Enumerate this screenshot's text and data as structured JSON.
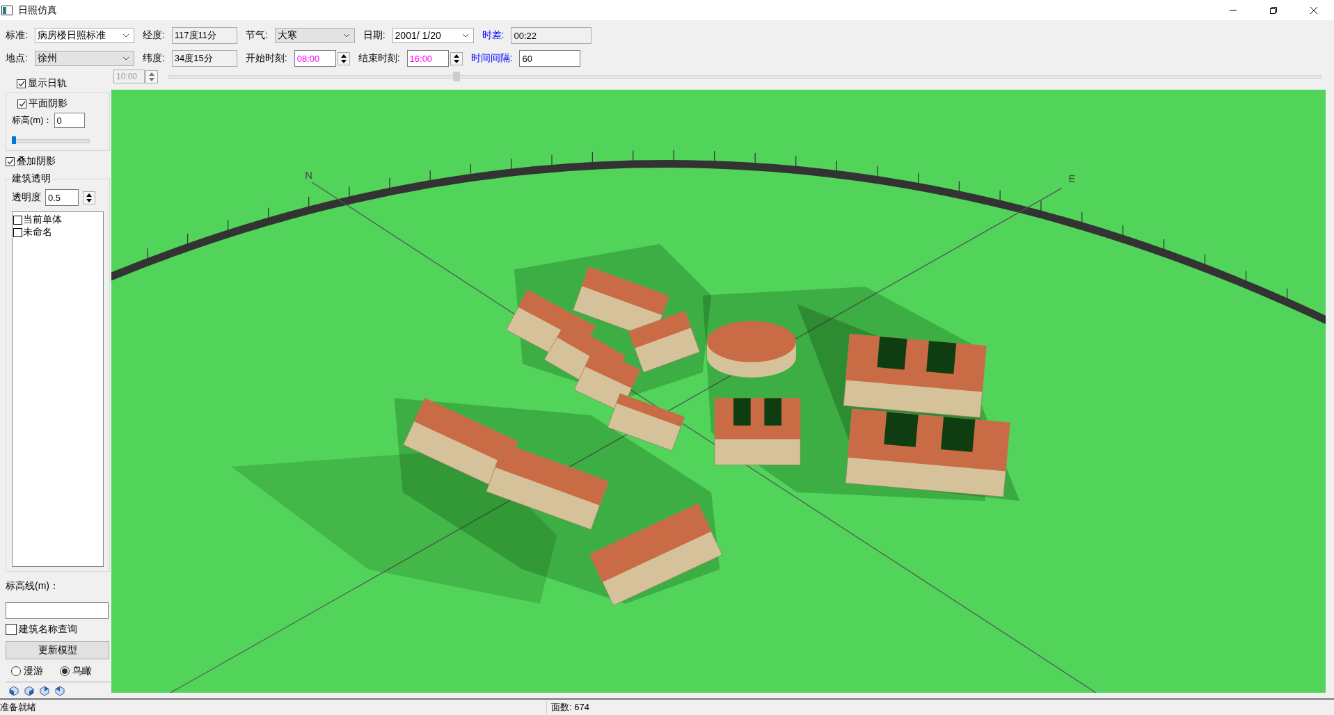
{
  "window": {
    "title": "日照仿真"
  },
  "toolbar": {
    "rows": [
      [
        {
          "label": "标准:",
          "kind": "combo",
          "value": "病房楼日照标准",
          "readonly": false,
          "accent": false
        },
        {
          "label": "经度:",
          "kind": "text",
          "value": "117度11分",
          "readonly": true,
          "accent": false
        },
        {
          "label": "节气:",
          "kind": "combo",
          "value": "大寒",
          "readonly": true,
          "accent": false
        },
        {
          "label": "日期:",
          "kind": "combo",
          "value": "2001/ 1/20",
          "readonly": false,
          "accent": false
        },
        {
          "label": "时差:",
          "kind": "text",
          "value": "00:22",
          "readonly": true,
          "accent": true
        }
      ],
      [
        {
          "label": "地点:",
          "kind": "combo",
          "value": "徐州",
          "readonly": true,
          "accent": false
        },
        {
          "label": "纬度:",
          "kind": "text",
          "value": "34度15分",
          "readonly": true,
          "accent": false
        },
        {
          "label": "开始时刻:",
          "kind": "spin",
          "value": "08:00",
          "readonly": false,
          "accent": false
        },
        {
          "label": "结束时刻:",
          "kind": "spin",
          "value": "16:00",
          "readonly": false,
          "accent": false
        },
        {
          "label": "时间间隔:",
          "kind": "text",
          "value": "60",
          "readonly": false,
          "accent": true
        }
      ]
    ]
  },
  "time_slider": {
    "value": "10:00",
    "disabled": true,
    "level": 0.25
  },
  "left_panel": {
    "show_sun_path": {
      "label": "显示日轨",
      "checked": true
    },
    "plane_shadow": {
      "label": "平面阴影",
      "checked": true,
      "elevation_label": "标高(m)：",
      "elevation_value": "0",
      "level": 0
    },
    "overlay_shadow": {
      "label": "叠加阴影",
      "checked": true
    },
    "transparency_group": {
      "title": "建筑透明",
      "opacity_label": "透明度",
      "opacity_value": "0.5",
      "items": [
        {
          "label": "当前单体",
          "checked": false
        },
        {
          "label": "未命名",
          "checked": false
        }
      ]
    },
    "contour_label": "标高线(m)：",
    "name_query": {
      "label": "建筑名称查询",
      "checked": false
    },
    "update_button": "更新模型",
    "view_modes": [
      {
        "label": "漫游",
        "selected": false
      },
      {
        "label": "鸟瞰",
        "selected": true
      }
    ]
  },
  "viewport": {
    "labels": [
      {
        "text": "N",
        "kind": "north"
      },
      {
        "text": "E",
        "kind": "east"
      }
    ]
  },
  "status_bar": {
    "message": "准备就绪",
    "face_count": "面数: 674"
  }
}
